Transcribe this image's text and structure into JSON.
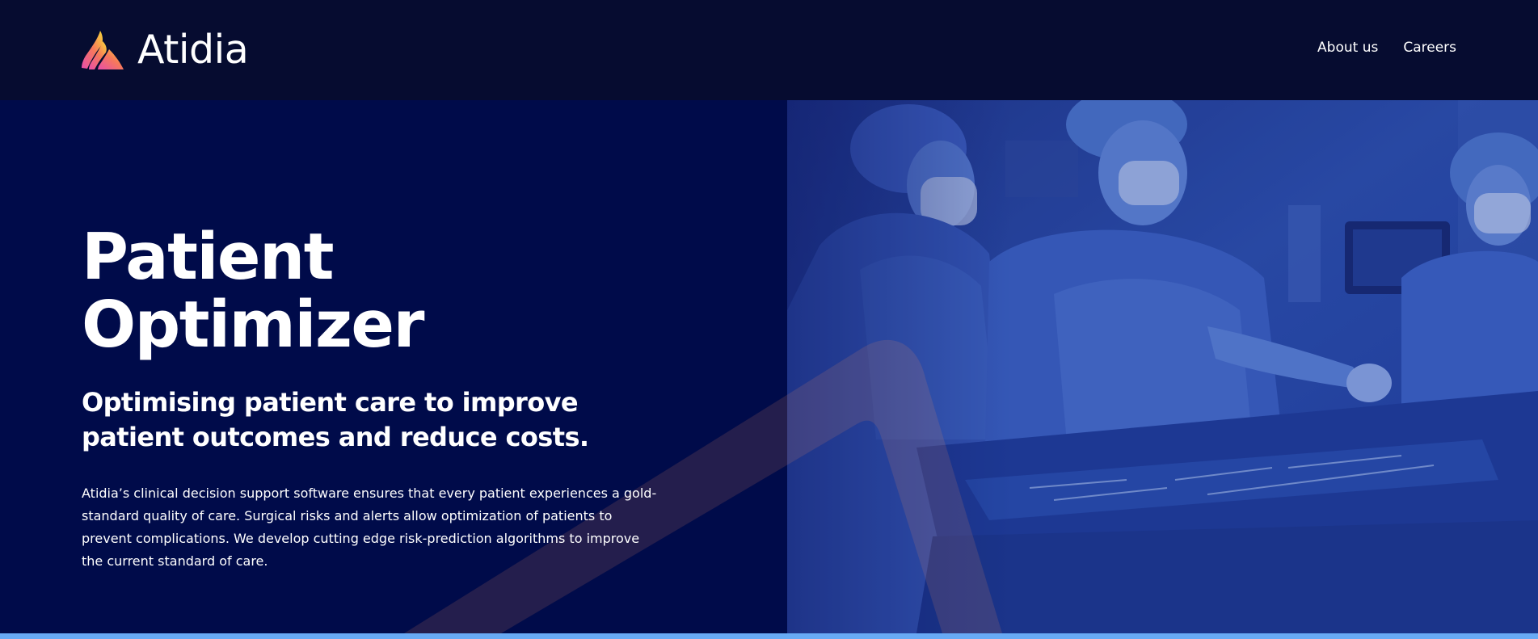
{
  "header": {
    "brand_name": "Atidia",
    "logo_icon": "atidia-flame-logo",
    "nav": [
      {
        "label": "About us"
      },
      {
        "label": "Careers"
      }
    ]
  },
  "hero": {
    "title": "Patient Optimizer",
    "subtitle": "Optimising patient care to improve patient outcomes and reduce costs.",
    "body": "Atidia’s clinical decision support software ensures that every patient experiences a gold-standard quality of care. Surgical risks and alerts allow optimization of patients to prevent complications. We develop cutting edge risk-prediction algorithms to improve the current standard of care.",
    "image": "surgeons-in-operating-room-photo"
  },
  "colors": {
    "header_background": "#060c30",
    "hero_background": "#000b4a",
    "text": "#ffffff",
    "accent_bar": "#68aaf5",
    "logo_gradient": [
      "#f7d83a",
      "#f77a59",
      "#e74dab"
    ]
  }
}
